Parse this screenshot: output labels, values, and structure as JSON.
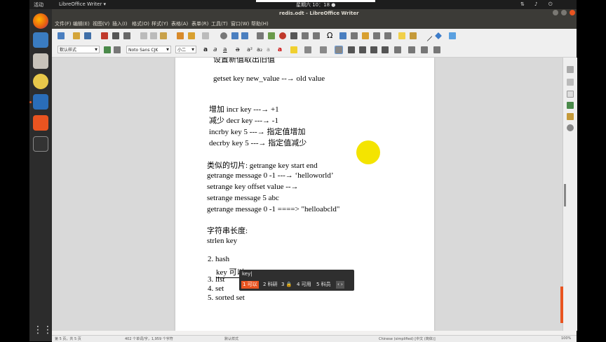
{
  "topbar": {
    "activities": "活动",
    "app_menu": "LibreOffice Writer ▾",
    "clock": "星期六 10：18 ●"
  },
  "window": {
    "title": "redis.odt - LibreOffice Writer"
  },
  "menus": [
    "文件(F)",
    "编辑(E)",
    "视图(V)",
    "插入(I)",
    "格式(O)",
    "样式(Y)",
    "表格(A)",
    "表单(R)",
    "工具(T)",
    "窗口(W)",
    "帮助(H)"
  ],
  "toolbar2": {
    "style": "默认样式",
    "font": "Noto Sans CJK",
    "size": "小二"
  },
  "document": {
    "lines": [
      {
        "id": "l0",
        "text": "设置新值取出旧值"
      },
      {
        "id": "l1",
        "text": "getset key new_value   --→ old value"
      },
      {
        "id": "l2",
        "text": "增加  incr key   ---→ +1"
      },
      {
        "id": "l3",
        "text": "减少  decr  key   ---→ -1"
      },
      {
        "id": "l4",
        "text": "incrby key 5     ---→ 指定值增加"
      },
      {
        "id": "l5",
        "text": "decrby key 5     ---→ 指定值减少"
      },
      {
        "id": "l6",
        "text": "类似的切片: getrange key start end"
      },
      {
        "id": "l7",
        "text": "getrange message 0 -1     ---→ ‘helloworld’"
      },
      {
        "id": "l8",
        "text": "setrange key offset value   --→"
      },
      {
        "id": "l9",
        "text": "setrange message 5 abc"
      },
      {
        "id": "l10",
        "text": "getrange message 0 -1     ====> \"helloabcld\""
      },
      {
        "id": "l11",
        "text": "字符串长度:"
      },
      {
        "id": "l12",
        "text": "strlen key"
      },
      {
        "id": "l13",
        "text": "2. hash"
      },
      {
        "id": "l14",
        "text": "key 可以"
      },
      {
        "id": "l15",
        "text": "3. list"
      },
      {
        "id": "l16",
        "text": "4. set"
      },
      {
        "id": "l17",
        "text": "5. sorted set"
      }
    ]
  },
  "ime": {
    "preedit": "key|",
    "candidates": [
      "1 可以",
      "2 科研",
      "3 🔒",
      "4 可用",
      "5 科员"
    ],
    "nav": "‹ ›"
  },
  "statusbar": {
    "page": "第 5 页，共 5 页",
    "words": "402 个单词/字，1,959 个字符",
    "style": "默认样式",
    "language": "Chinese (simplified) [中文 (简体)]",
    "zoom": "100%"
  }
}
